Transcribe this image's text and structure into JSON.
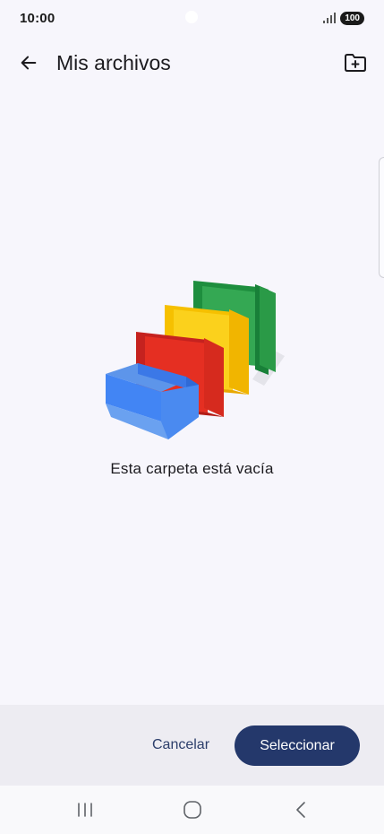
{
  "status_bar": {
    "time": "10:00",
    "battery": "100"
  },
  "header": {
    "title": "Mis archivos",
    "back_icon": "arrow-left-icon",
    "action_icon": "new-folder-icon"
  },
  "main": {
    "empty_message": "Esta carpeta está vacía",
    "illustration": "empty-folders-illustration"
  },
  "actions": {
    "cancel_label": "Cancelar",
    "select_label": "Seleccionar"
  },
  "nav": {
    "recents_icon": "recent-apps-icon",
    "home_icon": "home-icon",
    "back_icon": "back-chevron-icon"
  },
  "colors": {
    "background": "#f7f6fc",
    "primary": "#24386b",
    "panel": "#edecf2"
  }
}
